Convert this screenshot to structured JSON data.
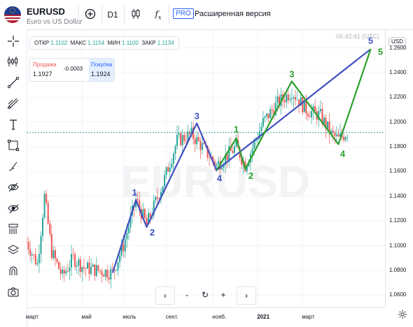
{
  "header": {
    "symbol": "EURUSD",
    "description": "Euro vs US Dollar",
    "add_icon": "plus-circle-icon",
    "timeframe": "D1",
    "chart_type_icon": "candles-icon",
    "indicators_icon": "fx-icon",
    "pro_badge": "PRO",
    "extended_label": "Расширенная версия"
  },
  "left_toolbar": [
    "crosshair-icon",
    "indicator-icon",
    "trendline-icon",
    "fib-icon",
    "text-icon",
    "rectangle-icon",
    "brush-icon",
    "hide-drawings-icon",
    "hide-indicators-icon",
    "object-tree-icon",
    "layers-icon",
    "magnet-icon",
    "snapshot-icon"
  ],
  "legend": {
    "open_label": "ОТКР",
    "open": "1.1102",
    "high_label": "МАКС",
    "high": "1.1154",
    "low_label": "МИН",
    "low": "1.1100",
    "close_label": "ЗАКР",
    "close": "1.1134"
  },
  "trade": {
    "sell_label": "Продажа",
    "sell_price": "1.1927",
    "spread": "-0.0003",
    "buy_label": "Покупка",
    "buy_price": "1.1924"
  },
  "clock": "06:42:41 (UTC)",
  "currency": "USD",
  "watermark": "EURUSD",
  "price_ticks": [
    "1.2600",
    "1.2400",
    "1.2200",
    "1.2000",
    "1.1800",
    "1.1600",
    "1.1400",
    "1.1200",
    "1.1000",
    "1.0800",
    "1.0600"
  ],
  "price_tick_values": [
    1.26,
    1.24,
    1.22,
    1.2,
    1.18,
    1.16,
    1.14,
    1.12,
    1.1,
    1.08,
    1.06
  ],
  "time_ticks": [
    "март",
    "май",
    "июль",
    "сент.",
    "нояб.",
    "2021",
    "март"
  ],
  "nav": [
    "‹",
    "-",
    "↻",
    "+",
    "›"
  ],
  "settings_icon": "gear-icon",
  "colors": {
    "blue_wave": "#3f4fbf",
    "green_wave": "#2ca02c",
    "up": "#26a69a",
    "down": "#ef5350",
    "current_price_line": "#26a69a"
  },
  "chart_data": {
    "type": "candlestick",
    "ylim": [
      1.05,
      1.275
    ],
    "current_price": 1.1915,
    "wave_primary": {
      "labels": [
        "1",
        "2",
        "3",
        "4",
        "5"
      ],
      "points": [
        {
          "label": "",
          "t": 0.24,
          "y": 1.078
        },
        {
          "label": "1",
          "t": 0.305,
          "y": 1.137
        },
        {
          "label": "2",
          "t": 0.335,
          "y": 1.115
        },
        {
          "label": "3",
          "t": 0.475,
          "y": 1.199
        },
        {
          "label": "4",
          "t": 0.53,
          "y": 1.161
        },
        {
          "label": "5",
          "t": 0.96,
          "y": 1.259
        }
      ]
    },
    "wave_secondary": {
      "points": [
        {
          "label": "",
          "t": 0.53,
          "y": 1.161
        },
        {
          "label": "1",
          "t": 0.585,
          "y": 1.187
        },
        {
          "label": "2",
          "t": 0.61,
          "y": 1.162
        },
        {
          "label": "3",
          "t": 0.74,
          "y": 1.233
        },
        {
          "label": "4",
          "t": 0.87,
          "y": 1.182
        },
        {
          "label": "5",
          "t": 0.96,
          "y": 1.259
        }
      ]
    }
  }
}
